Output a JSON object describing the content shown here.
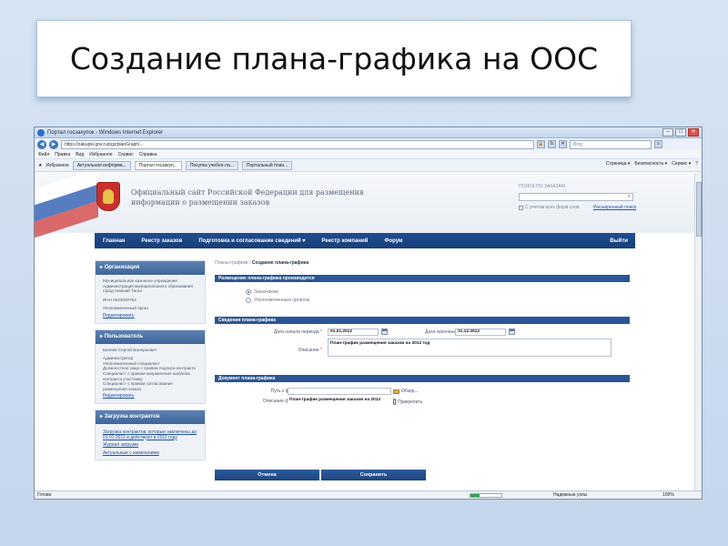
{
  "slide": {
    "title": "Создание плана-графика на ООС"
  },
  "browser": {
    "window_title": "Портал госзакупок - Windows Internet Explorer",
    "url": "https://zakupki.gov.ru/pgz/planGraph/...",
    "search_placeholder": "Bing",
    "menu": [
      "Файл",
      "Правка",
      "Вид",
      "Избранное",
      "Сервис",
      "Справка"
    ],
    "favorites_label": "Избранное",
    "tabs": [
      "Актуальная информа...",
      "Портал госзакуп...",
      "Покупка учебно-ла...",
      "Портальный план..."
    ],
    "tools": [
      "Страница ▾",
      "Безопасность ▾",
      "Сервис ▾",
      "?"
    ],
    "status_text": "Готово",
    "zone_text": "Надежные узлы",
    "zoom_text": "100%",
    "progress": 0.3
  },
  "site": {
    "name_line1": "Официальный сайт Российской Федерации для размещения",
    "name_line2": "информации о размещении заказов",
    "search_label": "ПОИСК ПО ЗАКАЗАМ",
    "search_option": "С учетом всех форм слов",
    "advanced_search": "Расширенный поиск",
    "nav": [
      "Главная",
      "Реестр заказов",
      "Подготовка и согласование сведений ▾",
      "Реестр компаний",
      "Форум"
    ],
    "nav_exit": "Выйти"
  },
  "sidebar": {
    "org": {
      "title": "Организация",
      "lines": [
        "Муниципальное казенное учреждение",
        "Администрация муниципального образования",
        "город Нижний Тагил"
      ],
      "inn": "ИНН 6623000754",
      "role": "Уполномоченный орган",
      "link": "Редактировать"
    },
    "user": {
      "title": "Пользователь",
      "name": "Беляев Сергей Валерьевич",
      "roles": [
        "Администратор",
        "Уполномоченный специалист",
        "Должностное лицо с правом подписи контракта",
        "Специалист с правом направления шаблона",
        "контракта участнику",
        "Специалист с правом согласования",
        "размещения заказа"
      ],
      "link": "Редактировать"
    },
    "contracts": {
      "title": "Загрузка контрактов",
      "link1": "Загрузка контрактов, которые заключены до 01.01.2011 и действуют в 2011 году",
      "link2": "Журнал загрузки",
      "link3": "Актуальные с изменением"
    }
  },
  "main": {
    "breadcrumb_prefix": "Планы-графики",
    "breadcrumb_sep": " / ",
    "breadcrumb_current": "Создание плана-графика",
    "sections": {
      "placement_title": "Размещение плана-графика производится",
      "radio1": "Заказчиком",
      "radio2": "Уполномоченным органом",
      "info_title": "Сведения плана-графика",
      "doc_title": "Документ плана-графика"
    },
    "form": {
      "start_label": "Дата начала периода",
      "start_value": "01.01.2012",
      "end_label": "Дата окончания периода",
      "end_value": "31.12.2012",
      "desc_label": "Описание",
      "desc_value": "План-график размещения заказов на 2012 год",
      "file_label": "Путь к файлу",
      "file_value": "",
      "browse": "Обзор...",
      "file_desc_label": "Описание файла",
      "file_desc_value": "План-график размещения заказов на 2012",
      "attach": "Прикрепить"
    },
    "buttons": {
      "cancel": "Отмена",
      "save": "Сохранить"
    }
  }
}
